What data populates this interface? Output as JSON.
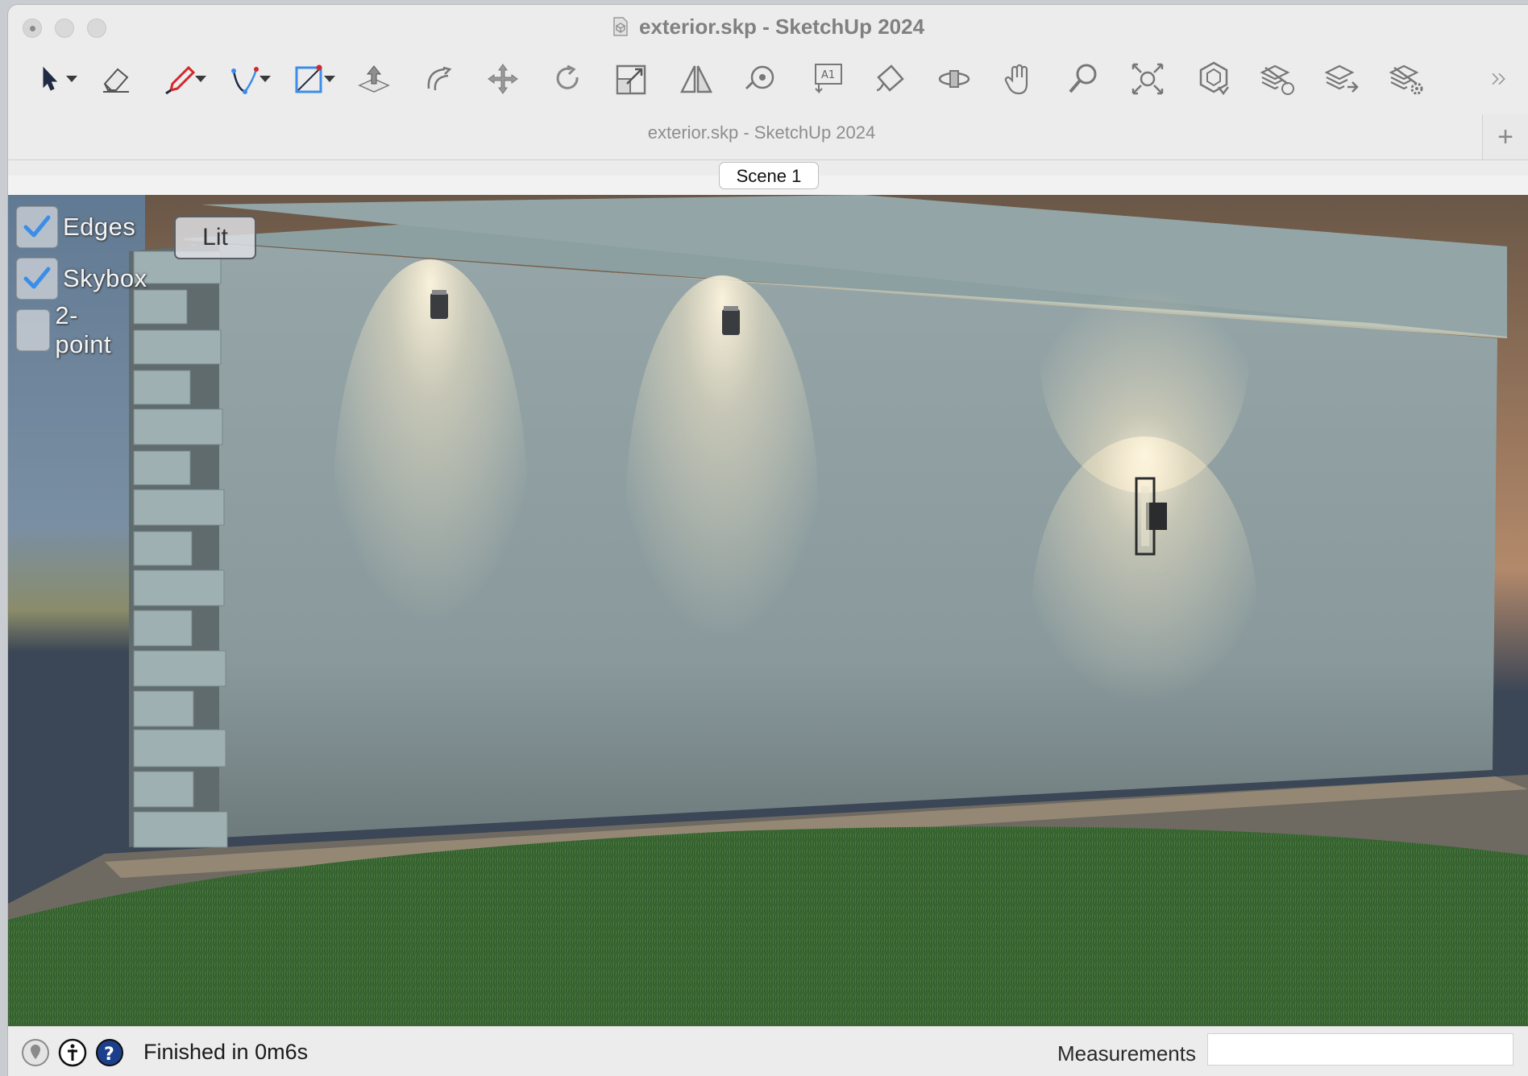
{
  "window": {
    "title": "exterior.skp - SketchUp 2024",
    "document_title": "exterior.skp - SketchUp 2024"
  },
  "toolbar": {
    "tools": [
      {
        "name": "select-tool",
        "icon": "arrow-cursor-icon",
        "has_dropdown": true
      },
      {
        "name": "eraser-tool",
        "icon": "eraser-icon",
        "has_dropdown": false
      },
      {
        "name": "line-tool",
        "icon": "pencil-icon",
        "has_dropdown": true
      },
      {
        "name": "arc-tool",
        "icon": "arc-icon",
        "has_dropdown": true
      },
      {
        "name": "rectangle-tool",
        "icon": "rectangle-icon",
        "has_dropdown": true
      },
      {
        "name": "push-pull-tool",
        "icon": "push-pull-icon",
        "has_dropdown": false
      },
      {
        "name": "offset-tool",
        "icon": "offset-icon",
        "has_dropdown": false
      },
      {
        "name": "move-tool",
        "icon": "move-icon",
        "has_dropdown": false
      },
      {
        "name": "rotate-tool",
        "icon": "rotate-icon",
        "has_dropdown": false
      },
      {
        "name": "scale-tool",
        "icon": "scale-icon",
        "has_dropdown": false
      },
      {
        "name": "flip-tool",
        "icon": "flip-icon",
        "has_dropdown": false
      },
      {
        "name": "tape-measure-tool",
        "icon": "tape-measure-icon",
        "has_dropdown": false
      },
      {
        "name": "text-tool",
        "icon": "text-icon",
        "has_dropdown": false
      },
      {
        "name": "paint-bucket-tool",
        "icon": "paint-bucket-icon",
        "has_dropdown": false
      },
      {
        "name": "orbit-tool",
        "icon": "orbit-icon",
        "has_dropdown": false
      },
      {
        "name": "pan-tool",
        "icon": "hand-icon",
        "has_dropdown": false
      },
      {
        "name": "zoom-tool",
        "icon": "magnifier-icon",
        "has_dropdown": false
      },
      {
        "name": "zoom-extents-tool",
        "icon": "zoom-extents-icon",
        "has_dropdown": false
      },
      {
        "name": "3d-warehouse-tool",
        "icon": "warehouse-icon",
        "has_dropdown": false
      },
      {
        "name": "render-settings-tool",
        "icon": "layers-refresh-icon",
        "has_dropdown": false
      },
      {
        "name": "export-tool",
        "icon": "layers-arrow-icon",
        "has_dropdown": false
      },
      {
        "name": "settings-tool",
        "icon": "layers-gear-icon",
        "has_dropdown": false
      }
    ],
    "overflow_icon": "chevron-double-right-icon",
    "text_tool_glyph": "A1"
  },
  "scene_tab": {
    "label": "Scene 1"
  },
  "viewport_overlay": {
    "checkboxes": [
      {
        "label": "Edges",
        "checked": true
      },
      {
        "label": "Skybox",
        "checked": true
      },
      {
        "label": "2-point",
        "checked": false
      }
    ],
    "lit_button": "Lit"
  },
  "statusbar": {
    "message": "Finished in 0m6s",
    "measurements_label": "Measurements",
    "measurements_value": ""
  },
  "colors": {
    "accent": "#3b8ee8",
    "wall": "#8d9ea0",
    "grass": "#3f6b35",
    "sky": "#3b4656"
  }
}
